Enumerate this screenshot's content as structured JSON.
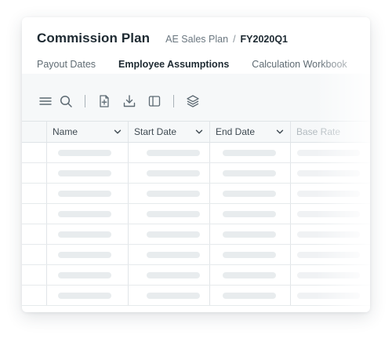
{
  "header": {
    "title": "Commission Plan",
    "breadcrumb_parent": "AE Sales Plan",
    "breadcrumb_separator": "/",
    "breadcrumb_current": "FY2020Q1"
  },
  "tabs": [
    {
      "label": "Payout Dates",
      "active": false
    },
    {
      "label": "Employee Assumptions",
      "active": true
    },
    {
      "label": "Calculation Workbook",
      "active": false
    }
  ],
  "toolbar": {
    "icons": [
      "menu-icon",
      "search-icon",
      "add-file-icon",
      "download-icon",
      "panel-icon",
      "layers-icon"
    ]
  },
  "table": {
    "columns": [
      "Name",
      "Start Date",
      "End Date",
      "Base Rate"
    ],
    "row_count": 8,
    "rows_loading": true
  },
  "colors": {
    "accent": "#2fa3b8",
    "title": "#1e2a32",
    "muted": "#6b7780",
    "skeleton": "#e8ecee"
  }
}
